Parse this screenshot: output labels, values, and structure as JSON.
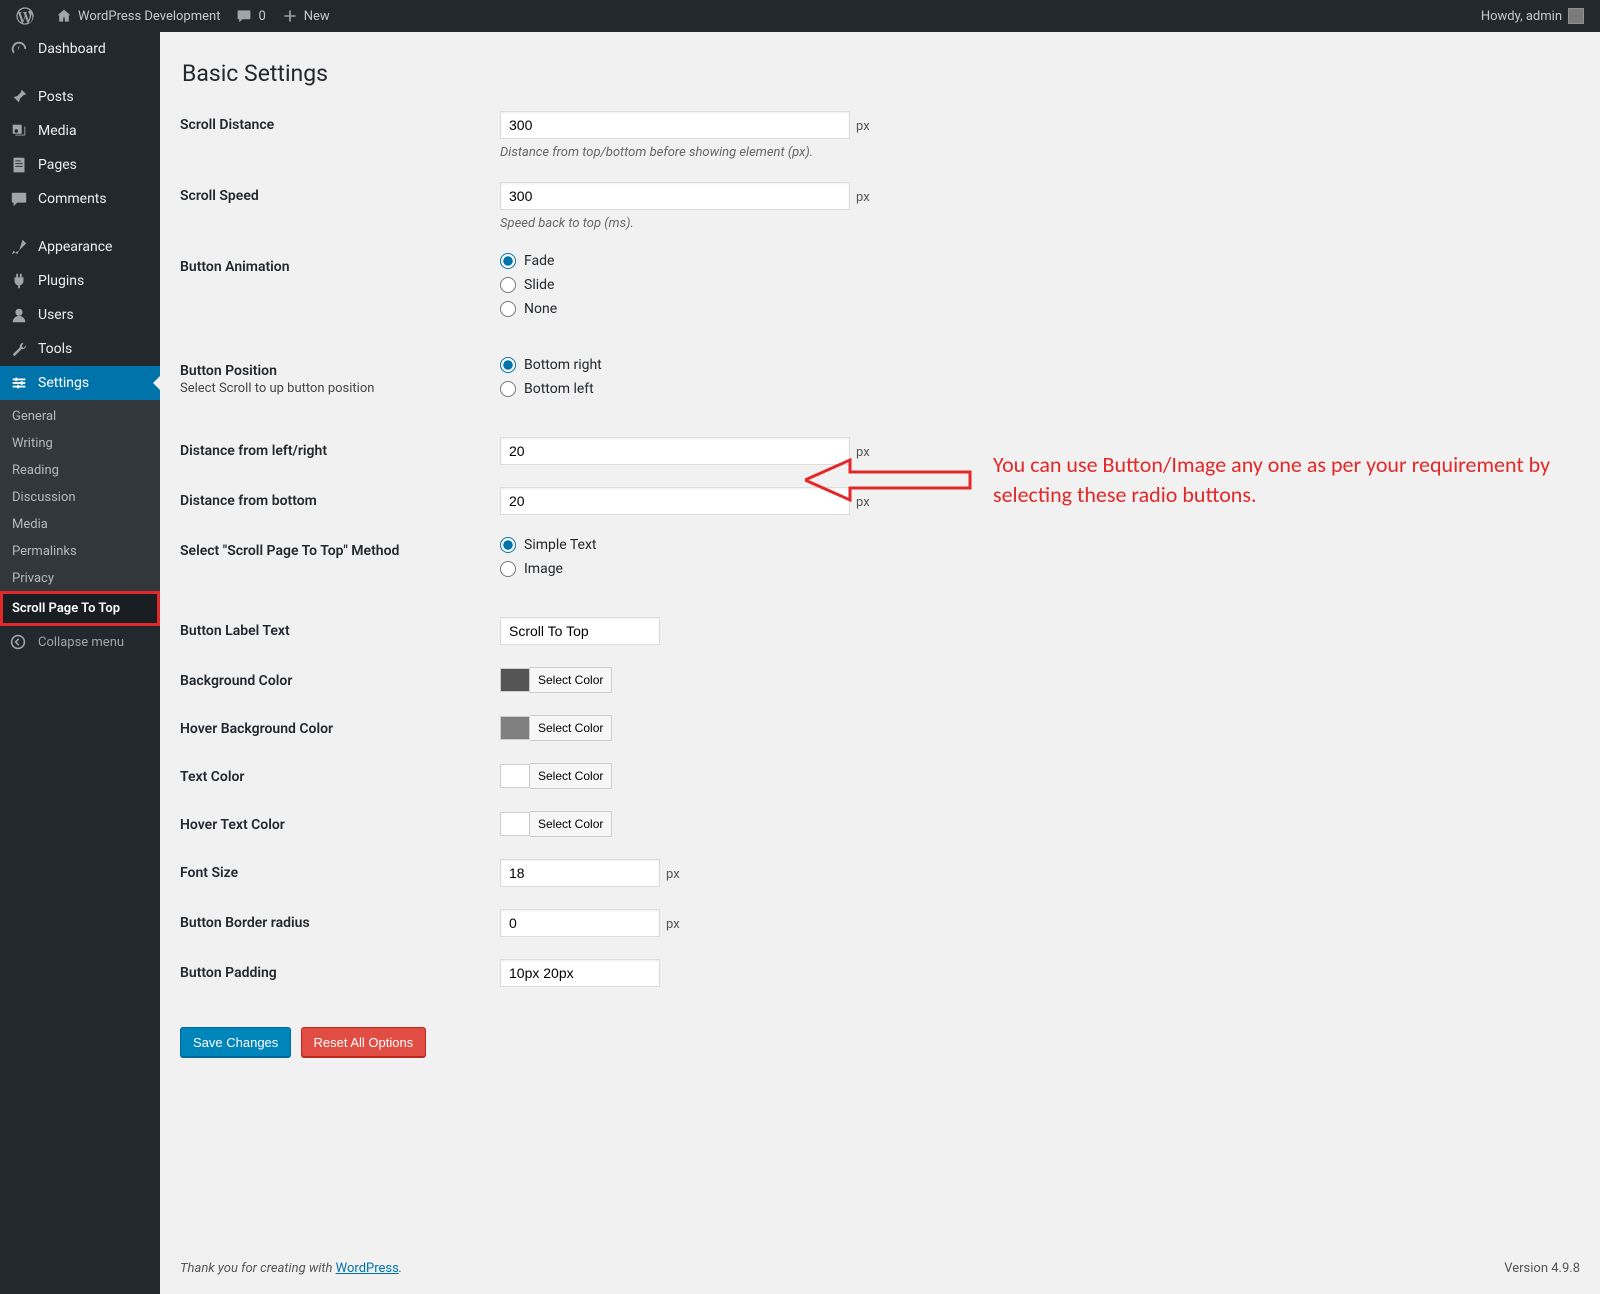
{
  "adminbar": {
    "site_name": "WordPress Development",
    "comments_count": "0",
    "new_label": "New",
    "howdy": "Howdy, admin"
  },
  "sidebar": {
    "items": [
      {
        "icon": "dashboard",
        "label": "Dashboard"
      },
      {
        "icon": "pin",
        "label": "Posts"
      },
      {
        "icon": "media",
        "label": "Media"
      },
      {
        "icon": "page",
        "label": "Pages"
      },
      {
        "icon": "comment",
        "label": "Comments"
      },
      {
        "icon": "brush",
        "label": "Appearance"
      },
      {
        "icon": "plug",
        "label": "Plugins"
      },
      {
        "icon": "user",
        "label": "Users"
      },
      {
        "icon": "wrench",
        "label": "Tools"
      },
      {
        "icon": "settings",
        "label": "Settings"
      }
    ],
    "submenu": [
      "General",
      "Writing",
      "Reading",
      "Discussion",
      "Media",
      "Permalinks",
      "Privacy",
      "Scroll Page To Top"
    ],
    "collapse": "Collapse menu"
  },
  "page": {
    "title": "Basic Settings"
  },
  "fields": {
    "scroll_distance": {
      "label": "Scroll Distance",
      "value": "300",
      "unit": "px",
      "desc": "Distance from top/bottom before showing element (px)."
    },
    "scroll_speed": {
      "label": "Scroll Speed",
      "value": "300",
      "unit": "px",
      "desc": "Speed back to top (ms)."
    },
    "button_animation": {
      "label": "Button Animation",
      "opts": [
        "Fade",
        "Slide",
        "None"
      ]
    },
    "button_position": {
      "label": "Button Position",
      "sub": "Select Scroll to up button position",
      "opts": [
        "Bottom right",
        "Bottom left"
      ]
    },
    "dist_lr": {
      "label": "Distance from left/right",
      "value": "20",
      "unit": "px"
    },
    "dist_bottom": {
      "label": "Distance from bottom",
      "value": "20",
      "unit": "px"
    },
    "method": {
      "label": "Select \"Scroll Page To Top\" Method",
      "opts": [
        "Simple Text",
        "Image"
      ]
    },
    "button_label_text": {
      "label": "Button Label Text",
      "value": "Scroll To Top"
    },
    "bg_color": {
      "label": "Background Color",
      "btn": "Select Color",
      "swatch": "#555555"
    },
    "hover_bg_color": {
      "label": "Hover Background Color",
      "btn": "Select Color",
      "swatch": "#808080"
    },
    "text_color": {
      "label": "Text Color",
      "btn": "Select Color",
      "swatch": "#ffffff"
    },
    "hover_text_color": {
      "label": "Hover Text Color",
      "btn": "Select Color",
      "swatch": "#ffffff"
    },
    "font_size": {
      "label": "Font Size",
      "value": "18",
      "unit": "px"
    },
    "border_radius": {
      "label": "Button Border radius",
      "value": "0",
      "unit": "px"
    },
    "padding": {
      "label": "Button Padding",
      "value": "10px 20px"
    }
  },
  "actions": {
    "save": "Save Changes",
    "reset": "Reset All Options"
  },
  "footer": {
    "thank": "Thank you for creating with ",
    "link": "WordPress",
    "dot": ".",
    "version": "Version 4.9.8"
  },
  "annotation": "You can use Button/Image any one as per your requirement by selecting these radio buttons."
}
